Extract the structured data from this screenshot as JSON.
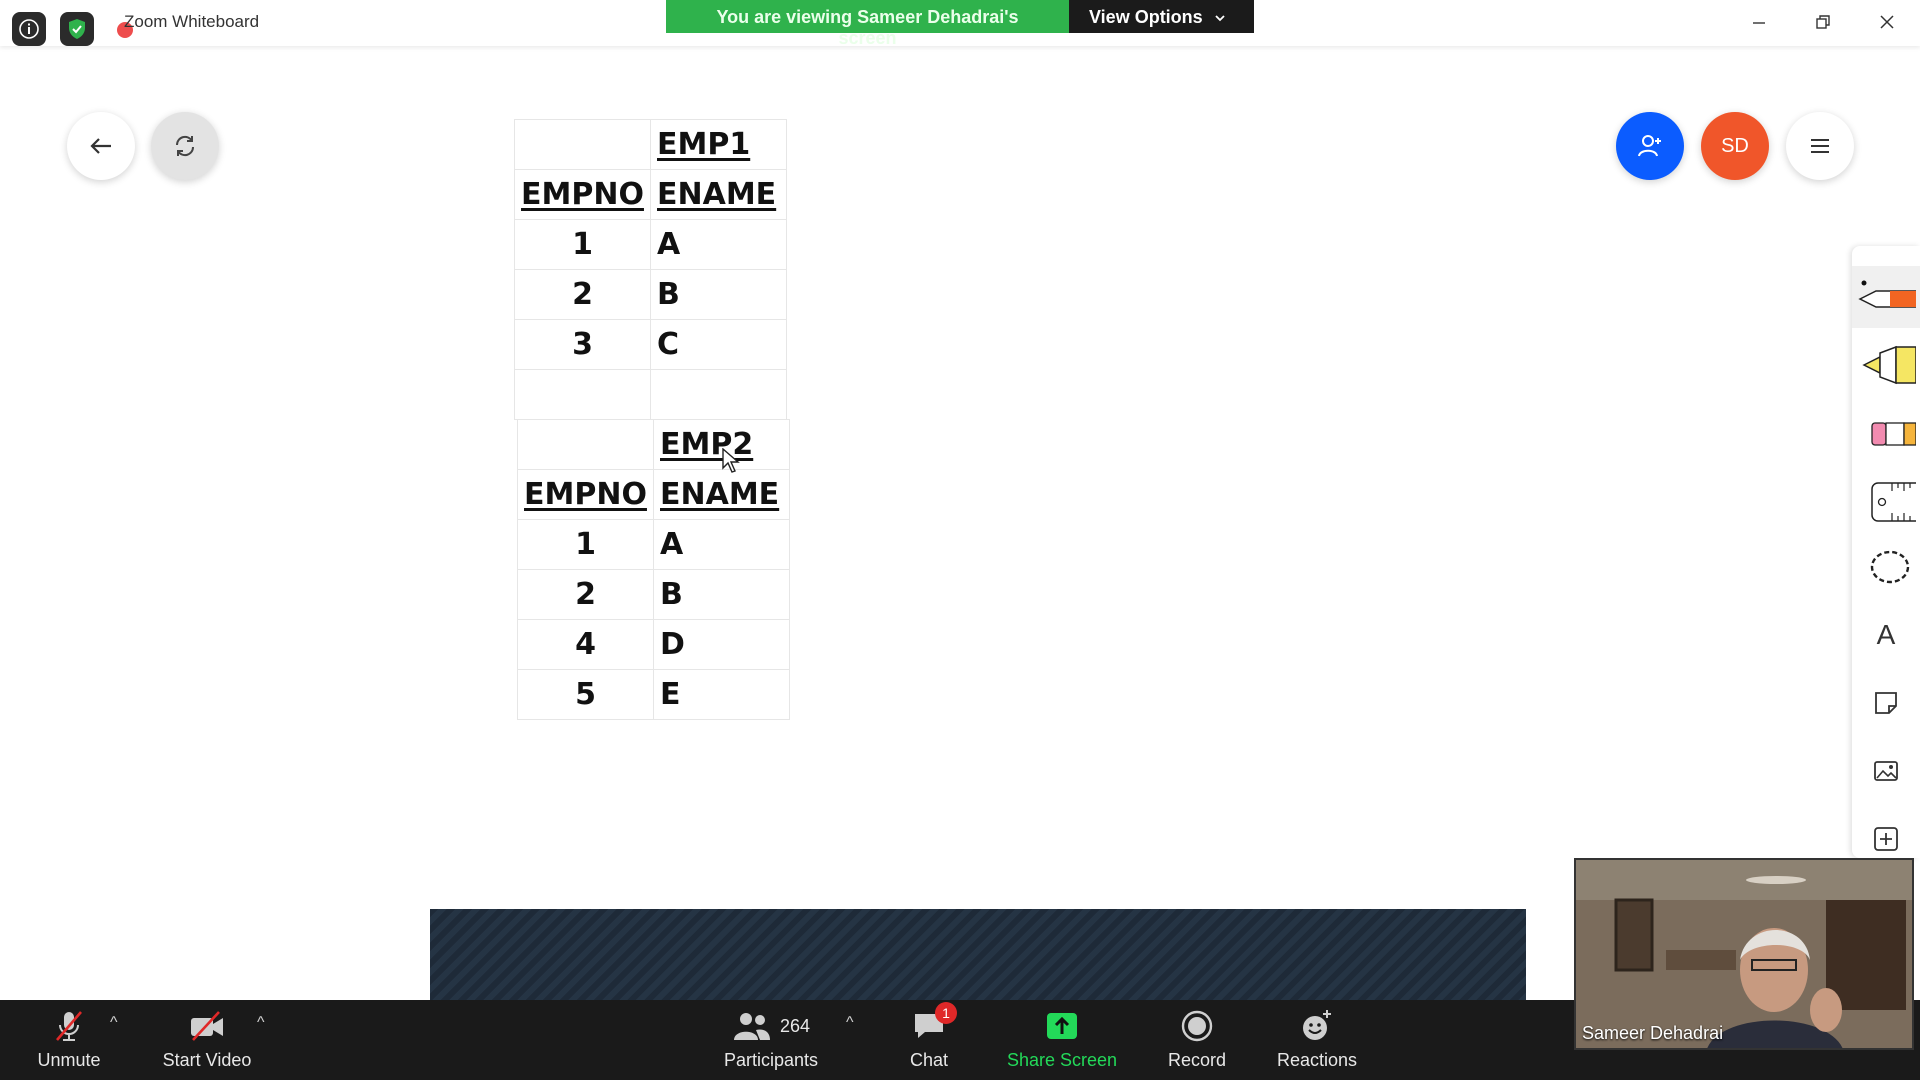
{
  "titlebar": {
    "title": "Zoom Whiteboard",
    "banner_text": "You are viewing Sameer Dehadrai's screen",
    "view_options_label": "View Options"
  },
  "canvas": {
    "avatar_initials": "SD",
    "tables": [
      {
        "name": "EMP1",
        "headers": [
          "EMPNO",
          "ENAME"
        ],
        "rows": [
          [
            "1",
            "A"
          ],
          [
            "2",
            "B"
          ],
          [
            "3",
            "C"
          ]
        ]
      },
      {
        "name": "EMP2",
        "headers": [
          "EMPNO",
          "ENAME"
        ],
        "rows": [
          [
            "1",
            "A"
          ],
          [
            "2",
            "B"
          ],
          [
            "4",
            "D"
          ],
          [
            "5",
            "E"
          ]
        ]
      }
    ]
  },
  "toolbar": {
    "text_tool_glyph": "A",
    "accent_pen": "#f26522",
    "accent_highlighter": "#f5e663",
    "accent_eraser": "#f28bb0"
  },
  "controls": {
    "unmute": "Unmute",
    "start_video": "Start Video",
    "participants": "Participants",
    "participant_count": "264",
    "chat": "Chat",
    "chat_badge": "1",
    "share_screen": "Share Screen",
    "record": "Record",
    "reactions": "Reactions"
  },
  "video": {
    "participant_name": "Sameer Dehadrai"
  },
  "colors": {
    "banner_green": "#2fb24c",
    "share_green": "#23d959",
    "avatar_blue": "#0b5cff",
    "avatar_orange": "#f0562a",
    "badge_red": "#e02828"
  }
}
